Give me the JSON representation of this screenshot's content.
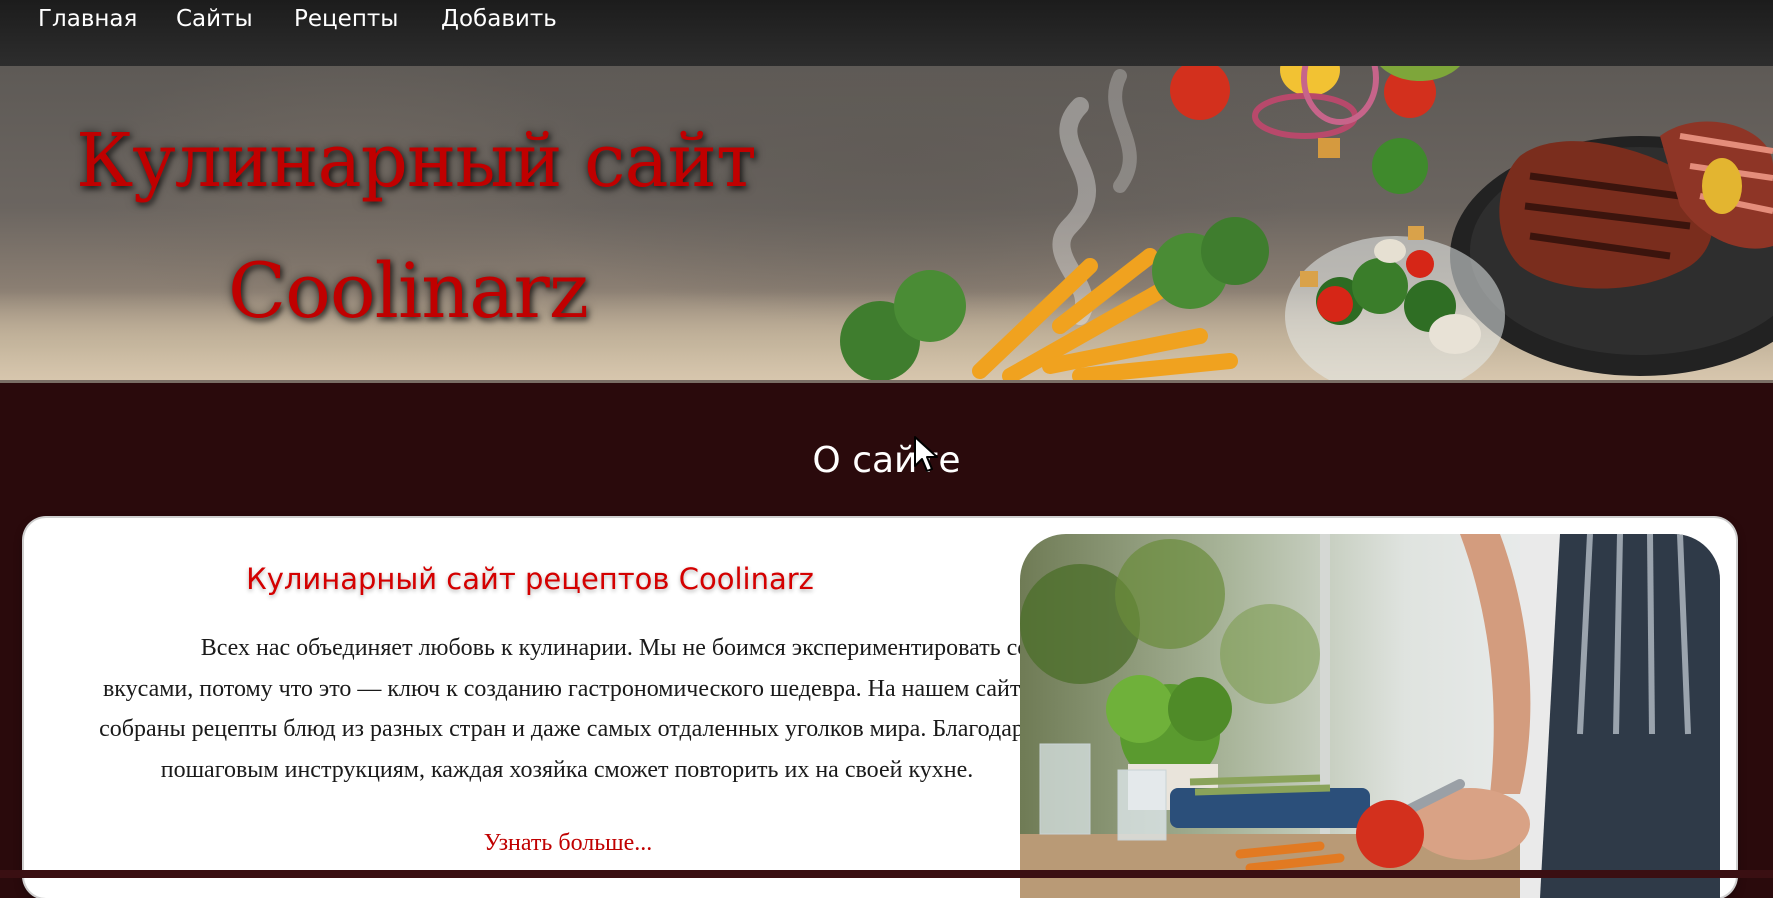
{
  "nav": {
    "items": [
      "Главная",
      "Сайты",
      "Рецепты",
      "Добавить"
    ]
  },
  "hero": {
    "title_line1": "Кулинарный сайт",
    "title_line2": "Coolinarz"
  },
  "about": {
    "title": "О сайте",
    "heading": "Кулинарный сайт рецептов Coolinarz",
    "text": "Всех нас объединяет любовь к кулинарии. Мы не боимся экспериментировать со вкусами, потому что это — ключ к созданию гастрономического шедевра. На нашем сайте собраны рецепты блюд из разных стран и даже самых отдаленных уголков мира. Благодаря пошаговым инструкциям, каждая хозяйка сможет повторить их на своей кухне.",
    "link": "Узнать больше..."
  },
  "colors": {
    "accent_red": "#c00000",
    "page_background": "#2a0a0c",
    "nav_background": "#262626"
  }
}
